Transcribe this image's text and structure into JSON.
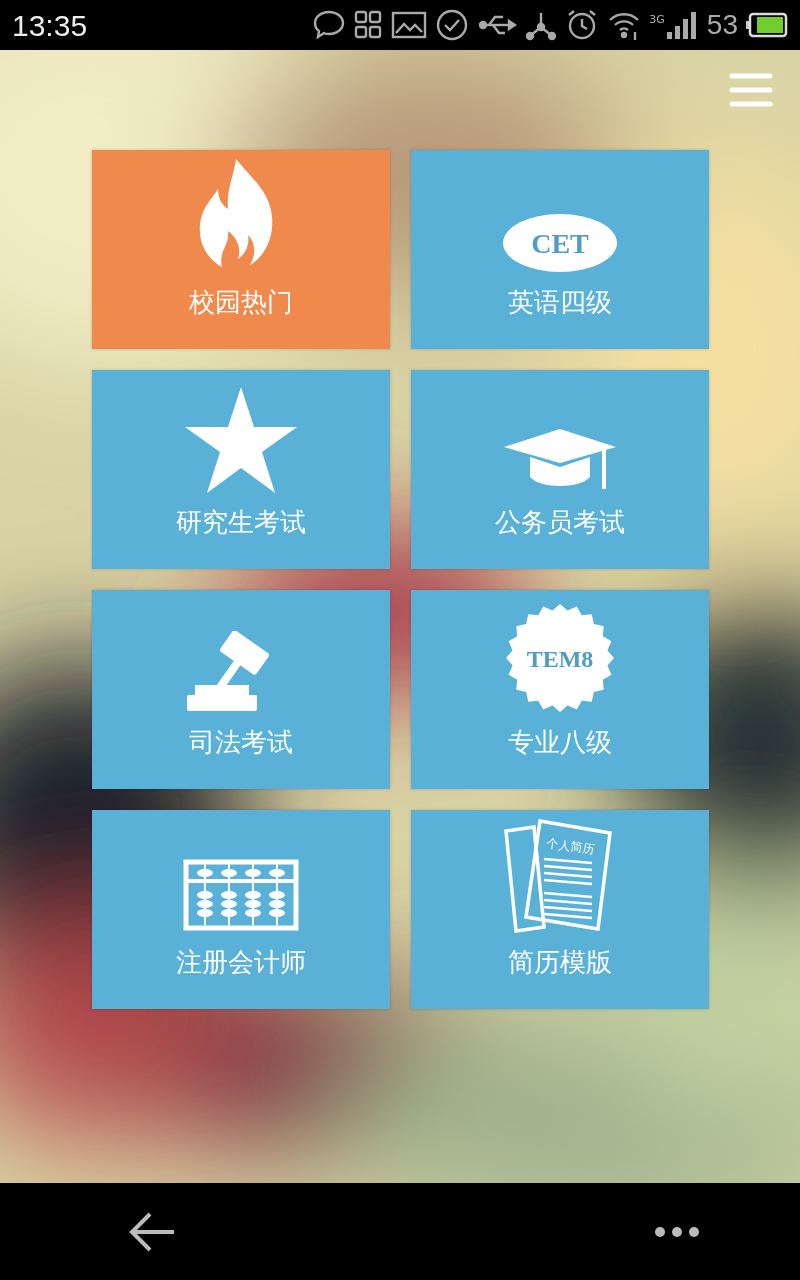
{
  "status_bar": {
    "time": "13:35",
    "network": "3G",
    "battery_text": "53"
  },
  "tile_rows": [
    {
      "tiles": [
        {
          "label": "校园热门",
          "kind": "flame",
          "color": "#ef8a4c"
        },
        {
          "label": "英语四级",
          "kind": "cet",
          "color": "#5ab1d8",
          "icon_text": "CET"
        }
      ]
    },
    {
      "tiles": [
        {
          "label": "研究生考试",
          "kind": "star",
          "color": "#5ab1d8"
        },
        {
          "label": "公务员考试",
          "kind": "cap",
          "color": "#5ab1d8"
        }
      ]
    },
    {
      "tiles": [
        {
          "label": "司法考试",
          "kind": "gavel",
          "color": "#5ab1d8"
        },
        {
          "label": "专业八级",
          "kind": "tem",
          "color": "#5ab1d8",
          "icon_text": "TEM8"
        }
      ]
    },
    {
      "tiles": [
        {
          "label": "注册会计师",
          "kind": "abacus",
          "color": "#5ab1d8"
        },
        {
          "label": "简历模版",
          "kind": "resume",
          "color": "#5ab1d8",
          "icon_text": "个人简历"
        }
      ]
    }
  ]
}
